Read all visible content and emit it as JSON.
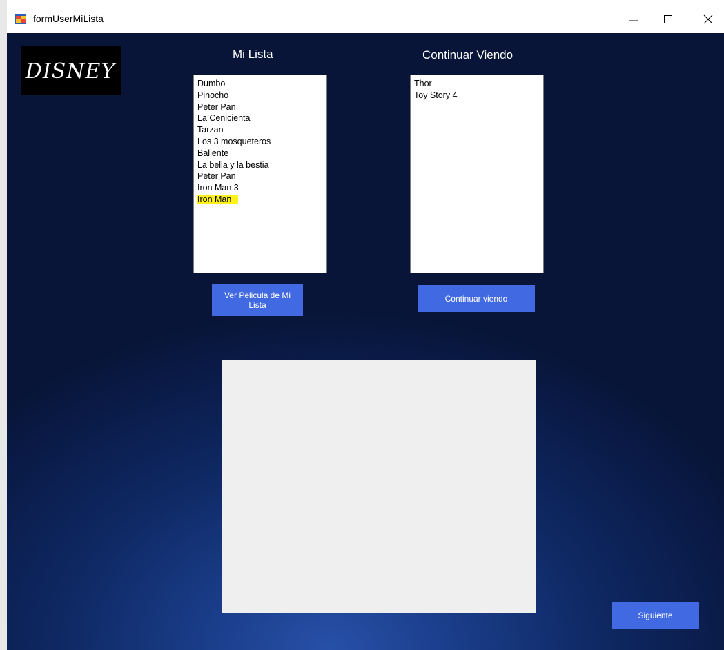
{
  "window": {
    "title": "formUserMiLista"
  },
  "logo": {
    "text": "DISNEY"
  },
  "mi_lista": {
    "heading": "Mi Lista",
    "items": [
      "Dumbo",
      "Pinocho",
      "Peter Pan",
      "La Cenicienta",
      "Tarzan",
      "Los 3 mosqueteros",
      "Baliente",
      "La bella y la bestia",
      "Peter Pan",
      "Iron Man 3",
      "Iron Man"
    ],
    "highlighted_item": "Iron Man",
    "button_label": "Ver Pelicula de Mi Lista"
  },
  "continuar_viendo": {
    "heading": "Continuar Viendo",
    "items": [
      "Thor",
      "Toy Story 4"
    ],
    "button_label": "Continuar viendo"
  },
  "footer": {
    "next_label": "Siguiente"
  },
  "colors": {
    "button": "#4169e1",
    "background": "#0f2a66",
    "highlight": "#fff21a"
  }
}
